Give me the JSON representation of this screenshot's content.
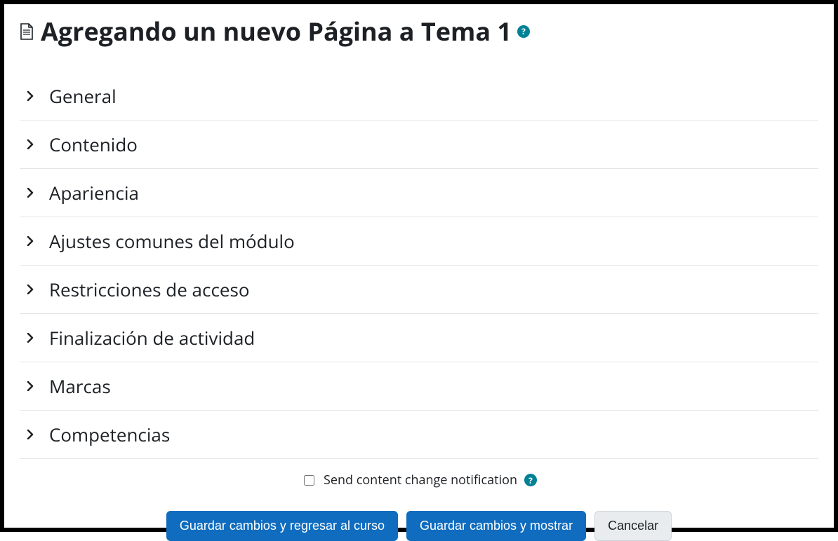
{
  "header": {
    "title": "Agregando un nuevo Página a Tema 1"
  },
  "sections": [
    {
      "label": "General"
    },
    {
      "label": "Contenido"
    },
    {
      "label": "Apariencia"
    },
    {
      "label": "Ajustes comunes del módulo"
    },
    {
      "label": "Restricciones de acceso"
    },
    {
      "label": "Finalización de actividad"
    },
    {
      "label": "Marcas"
    },
    {
      "label": "Competencias"
    }
  ],
  "notify": {
    "label": "Send content change notification"
  },
  "actions": {
    "save_return": "Guardar cambios y regresar al curso",
    "save_display": "Guardar cambios y mostrar",
    "cancel": "Cancelar"
  }
}
